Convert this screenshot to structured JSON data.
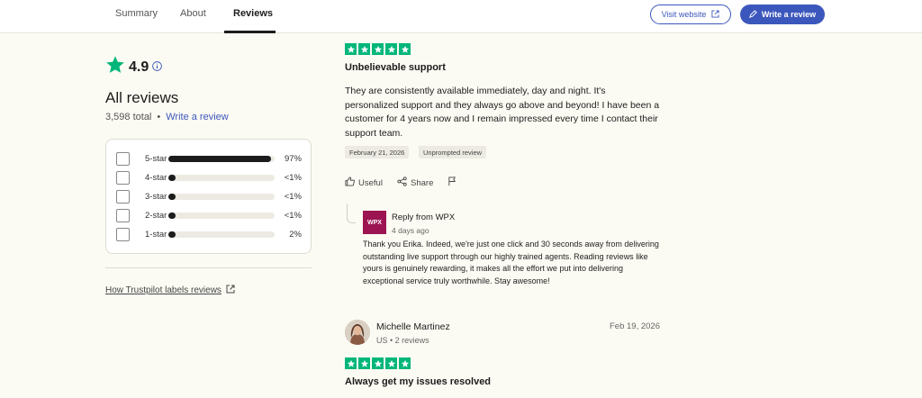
{
  "nav": {
    "tabs": [
      {
        "label": "Summary"
      },
      {
        "label": "About"
      },
      {
        "label": "Reviews"
      }
    ],
    "visit_label": "Visit website",
    "write_label": "Write a review"
  },
  "summary": {
    "rating": "4.9",
    "heading": "All reviews",
    "total": "3,598 total",
    "separator": "•",
    "write_link": "Write a review",
    "distribution": [
      {
        "label": "5-star",
        "pct": "97%",
        "fill": 0.97
      },
      {
        "label": "4-star",
        "pct": "<1%",
        "fill": 0.01
      },
      {
        "label": "3-star",
        "pct": "<1%",
        "fill": 0.01
      },
      {
        "label": "2-star",
        "pct": "<1%",
        "fill": 0.01
      },
      {
        "label": "1-star",
        "pct": "2%",
        "fill": 0.02
      }
    ],
    "labels_link": "How Trustpilot labels reviews"
  },
  "review1": {
    "stars": 5,
    "title": "Unbelievable support",
    "body": "They are consistently available immediately, day and night. It's personalized support and they always go above and beyond! I have been a customer for 4 years now and I remain impressed every time I contact their support team.",
    "date_chip": "February 21, 2026",
    "label_chip": "Unprompted review",
    "actions": {
      "useful": "Useful",
      "share": "Share"
    },
    "reply": {
      "logo_text": "WPX",
      "from": "Reply from WPX",
      "age": "4 days ago",
      "body": "Thank you Erika. Indeed, we're just one click and 30 seconds away from delivering outstanding live support through our highly trained agents. Reading reviews like yours is genuinely rewarding, it makes all the effort we put into delivering exceptional service truly worthwhile. Stay awesome!"
    }
  },
  "review2": {
    "name": "Michelle Martinez",
    "meta": "US • 2 reviews",
    "date": "Feb 19, 2026",
    "stars": 5,
    "title": "Always get my issues resolved"
  },
  "colors": {
    "accent": "#3c57bc",
    "trust_green": "#00b67a",
    "reply_brand": "#9c1552",
    "background": "#fcfbf3"
  }
}
